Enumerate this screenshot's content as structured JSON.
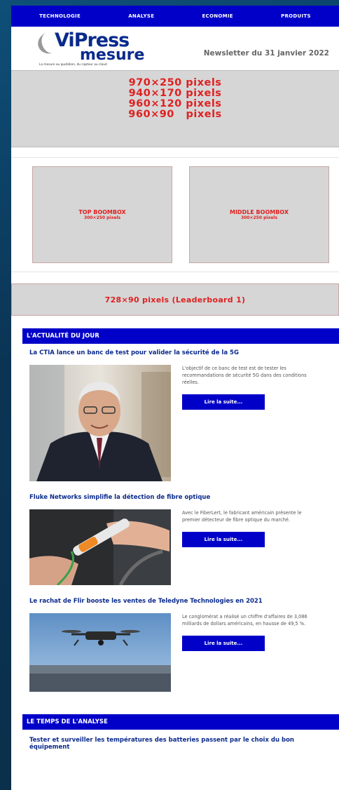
{
  "nav": [
    "TECHNOLOGIE",
    "ANALYSE",
    "ECONOMIE",
    "PRODUITS"
  ],
  "logo": {
    "vi": "Vi",
    "press": "Press",
    "mesure": "mesure",
    "tagline": "La mesure au quotidien, du capteur au cloud"
  },
  "newsletter_date": "Newsletter du 31 janvier 2022",
  "banner_sizes": [
    "970×250 pixels",
    "940×170 pixels",
    "960×120 pixels",
    "960×90   pixels"
  ],
  "boombox": [
    {
      "title": "TOP BOOMBOX",
      "size": "300×250 pixels"
    },
    {
      "title": "MIDDLE BOOMBOX",
      "size": "300×250 pixels"
    }
  ],
  "leaderboard": "728×90 pixels (Leaderboard 1)",
  "section_actu": "L'ACTUALITÉ DU JOUR",
  "articles": [
    {
      "title": "La CTIA lance un banc de test pour valider la sécurité de la 5G",
      "summary": "L'objectif de ce banc de test est de tester les recommandations de sécurité 5G dans des conditions réelles.",
      "cta": "Lire la suite...",
      "image": "man-portrait"
    },
    {
      "title": "Fluke Networks simplifie la détection de fibre optique",
      "summary": "Avec le FiberLert, le fabricant américain présente le premier détecteur de fibre optique du marché.",
      "cta": "Lire la suite...",
      "image": "fiber-detector"
    },
    {
      "title": "Le rachat de Flir booste les ventes de Teledyne Technologies en 2021",
      "summary": "Le conglomérat a réalisé un chiffre d'affaires de 3,086 milliards de dollars américains, en hausse de 49,5 %.",
      "cta": "Lire la suite...",
      "image": "drone"
    }
  ],
  "section_analyse": "LE TEMPS DE L'ANALYSE",
  "analyse_title": "Tester et surveiller les températures des batteries passent par le choix du bon équipement"
}
